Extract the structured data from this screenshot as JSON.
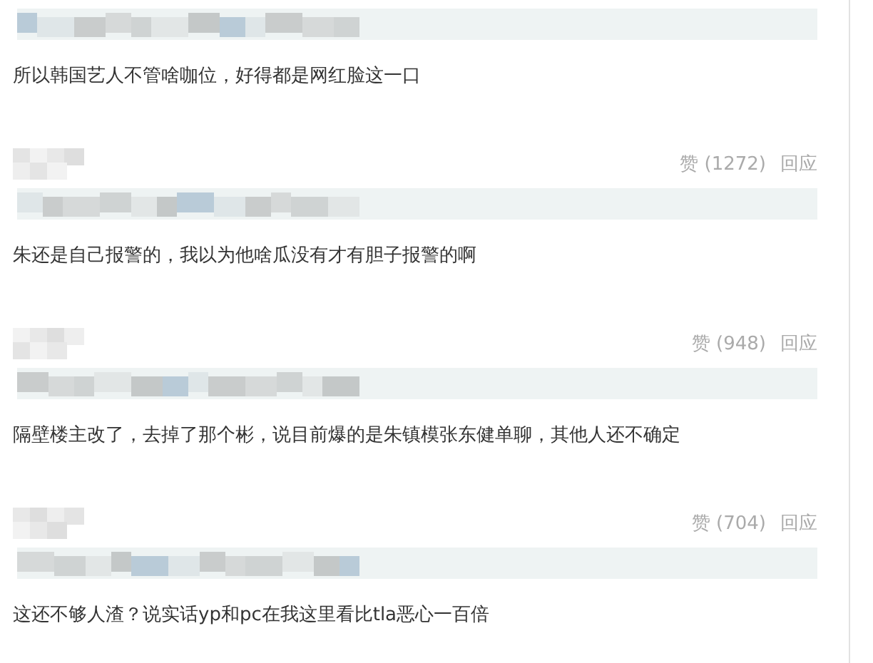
{
  "comments": [
    {
      "text": "所以韩国艺人不管啥咖位，好得都是网红脸这一口"
    },
    {
      "likes": "赞 (1272)",
      "reply": "回应",
      "text": "朱还是自己报警的，我以为他啥瓜没有才有胆子报警的啊"
    },
    {
      "likes": "赞 (948)",
      "reply": "回应",
      "text": "隔壁楼主改了，去掉了那个彬，说目前爆的是朱镇模张东健单聊，其他人还不确定"
    },
    {
      "likes": "赞 (704)",
      "reply": "回应",
      "text": "这还不够人渣？说实话yp和pc在我这里看比tla恶心一百倍"
    }
  ]
}
